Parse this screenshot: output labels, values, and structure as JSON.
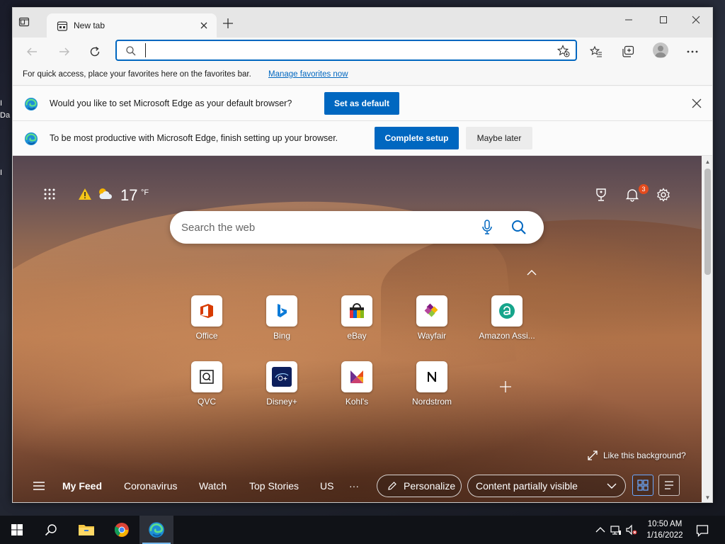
{
  "desktop": {
    "fragment_top": "I",
    "fragment_mid": "Da",
    "fragment_low": "I"
  },
  "browser": {
    "tab": {
      "title": "New tab"
    },
    "address_bar": {
      "value": "",
      "placeholder": ""
    },
    "favorites_bar": {
      "message": "For quick access, place your favorites here on the favorites bar.",
      "link": "Manage favorites now"
    },
    "default_prompt": {
      "message": "Would you like to set Microsoft Edge as your default browser?",
      "button": "Set as default"
    },
    "setup_prompt": {
      "message": "To be most productive with Microsoft Edge, finish setting up your browser.",
      "primary_button": "Complete setup",
      "secondary_button": "Maybe later"
    }
  },
  "new_tab_page": {
    "weather": {
      "temperature": "17",
      "unit": "°F"
    },
    "notifications_count": "3",
    "search": {
      "placeholder": "Search the web"
    },
    "quick_links": [
      {
        "label": "Office"
      },
      {
        "label": "Bing"
      },
      {
        "label": "eBay"
      },
      {
        "label": "Wayfair"
      },
      {
        "label": "Amazon Assi..."
      },
      {
        "label": "QVC"
      },
      {
        "label": "Disney+"
      },
      {
        "label": "Kohl's"
      },
      {
        "label": "Nordstrom"
      }
    ],
    "like_background": "Like this background?",
    "feed": {
      "tabs": [
        "My Feed",
        "Coronavirus",
        "Watch",
        "Top Stories",
        "US"
      ],
      "more": "···",
      "personalize": "Personalize",
      "visibility": "Content partially visible"
    }
  },
  "taskbar": {
    "time": "10:50 AM",
    "date": "1/16/2022"
  },
  "colors": {
    "accent": "#0067c0",
    "notification_badge": "#e34b1e",
    "taskbar": "#101217"
  }
}
